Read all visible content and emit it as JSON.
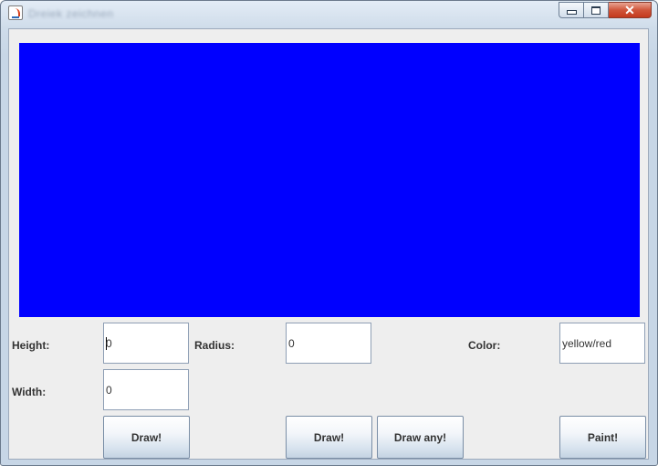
{
  "window": {
    "title": "Dreiek zeichnen",
    "min_icon": "minimize-icon",
    "max_icon": "maximize-icon",
    "close_glyph": "✕"
  },
  "canvas": {
    "color": "#0000ff"
  },
  "form": {
    "height_label": "Height:",
    "height_value": "0",
    "width_label": "Width:",
    "width_value": "0",
    "radius_label": "Radius:",
    "radius_value": "0",
    "color_label": "Color:",
    "color_value": "yellow/red"
  },
  "buttons": {
    "draw_rect": "Draw!",
    "draw_circle": "Draw!",
    "draw_any": "Draw any!",
    "paint": "Paint!"
  }
}
